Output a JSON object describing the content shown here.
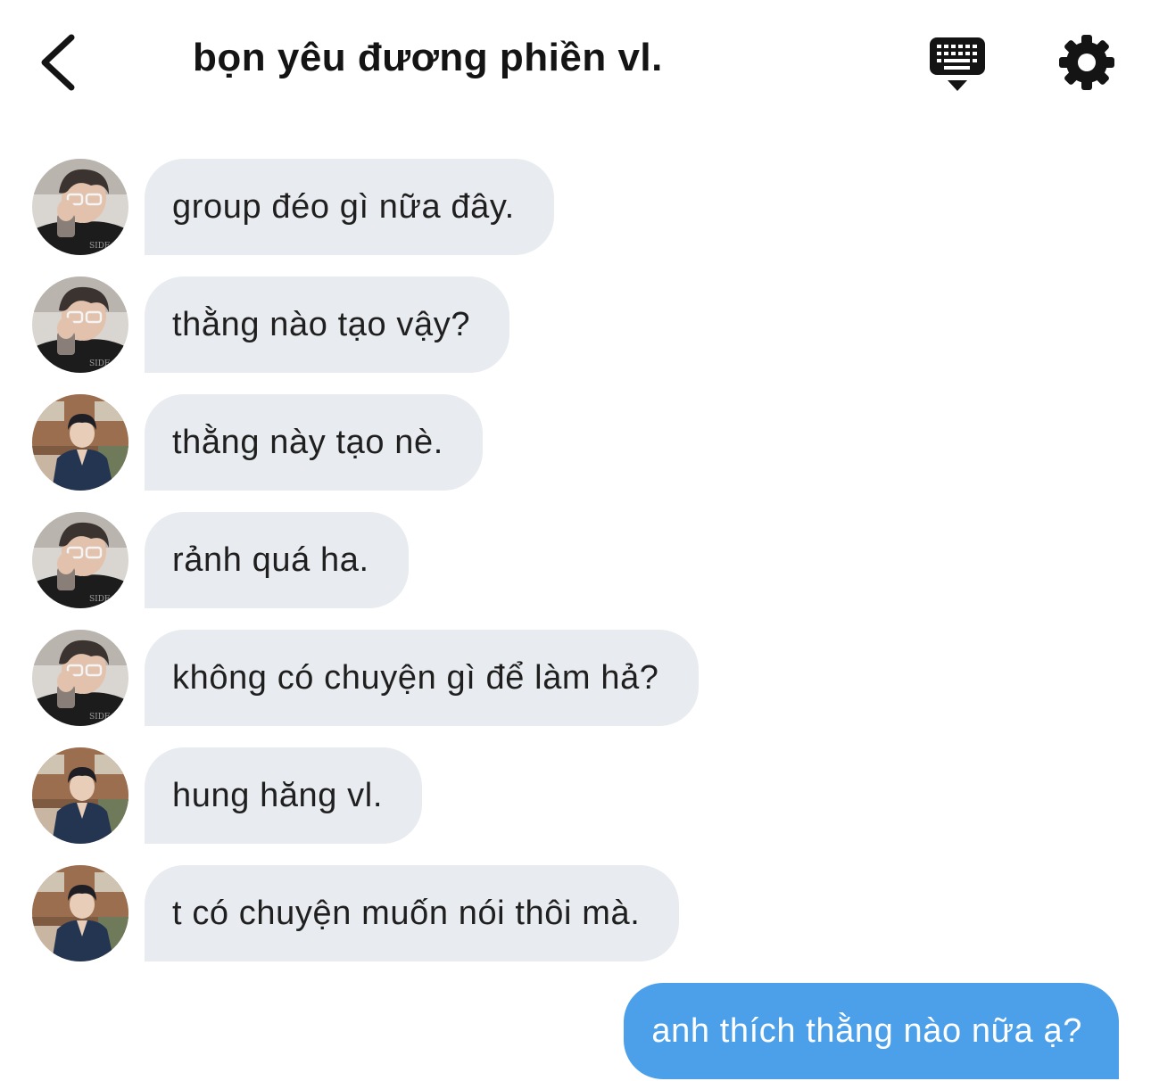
{
  "header": {
    "title": "bọn yêu đương phiền vl.",
    "back_icon": "chevron-left-icon",
    "keyboard_icon": "keyboard-hide-icon",
    "settings_icon": "gear-icon"
  },
  "colors": {
    "incoming_bubble": "#e8ebef",
    "outgoing_bubble": "#4ca0ea",
    "text": "#1f1f1f",
    "outgoing_text": "#ffffff"
  },
  "messages": [
    {
      "sender": "avatar-a",
      "text": "group đéo gì nữa đây."
    },
    {
      "sender": "avatar-a",
      "text": "thằng nào tạo vậy?"
    },
    {
      "sender": "avatar-b",
      "text": "thằng này tạo nè."
    },
    {
      "sender": "avatar-a",
      "text": "rảnh quá ha."
    },
    {
      "sender": "avatar-a",
      "text": "không có chuyện gì để làm hả?"
    },
    {
      "sender": "avatar-b",
      "text": "hung hăng vl."
    },
    {
      "sender": "avatar-b",
      "text": "t có chuyện muốn nói thôi mà."
    },
    {
      "sender": "me",
      "text": "anh thích thằng nào nữa ạ?"
    }
  ]
}
